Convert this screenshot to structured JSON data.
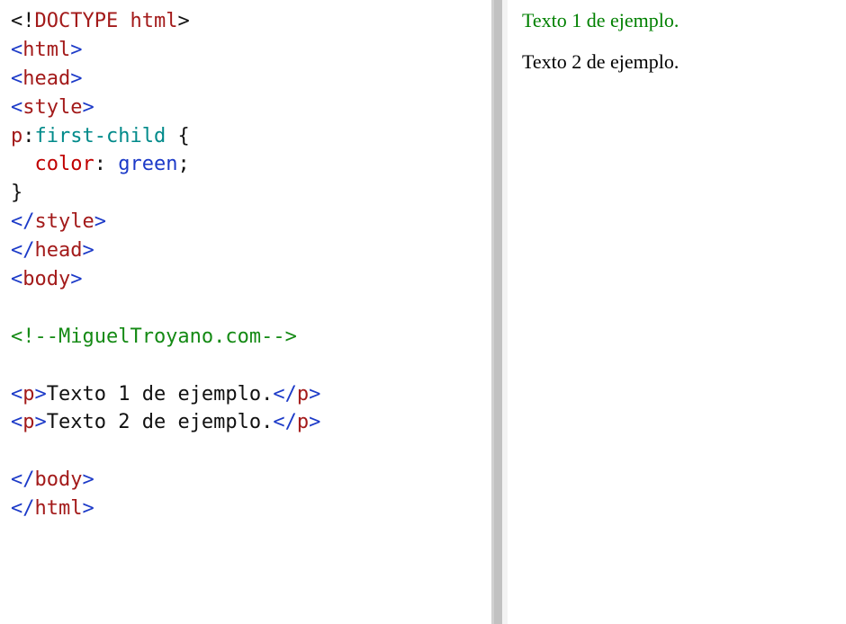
{
  "code": {
    "lines": [
      [
        {
          "cls": "t-punct",
          "text": "<!"
        },
        {
          "cls": "t-tag",
          "text": "DOCTYPE"
        },
        {
          "cls": "t-text",
          "text": " "
        },
        {
          "cls": "t-tag",
          "text": "html"
        },
        {
          "cls": "t-punct",
          "text": ">"
        }
      ],
      [
        {
          "cls": "t-angles",
          "text": "<"
        },
        {
          "cls": "t-tag",
          "text": "html"
        },
        {
          "cls": "t-angles",
          "text": ">"
        }
      ],
      [
        {
          "cls": "t-angles",
          "text": "<"
        },
        {
          "cls": "t-tag",
          "text": "head"
        },
        {
          "cls": "t-angles",
          "text": ">"
        }
      ],
      [
        {
          "cls": "t-angles",
          "text": "<"
        },
        {
          "cls": "t-tag",
          "text": "style"
        },
        {
          "cls": "t-angles",
          "text": ">"
        }
      ],
      [
        {
          "cls": "t-tag",
          "text": "p"
        },
        {
          "cls": "t-punct",
          "text": ":"
        },
        {
          "cls": "t-pseudo",
          "text": "first-child"
        },
        {
          "cls": "t-text",
          "text": " "
        },
        {
          "cls": "t-punct",
          "text": "{"
        }
      ],
      [
        {
          "cls": "t-text",
          "text": "  "
        },
        {
          "cls": "t-prop",
          "text": "color"
        },
        {
          "cls": "t-punct",
          "text": ": "
        },
        {
          "cls": "t-val",
          "text": "green"
        },
        {
          "cls": "t-punct",
          "text": ";"
        }
      ],
      [
        {
          "cls": "t-punct",
          "text": "}"
        }
      ],
      [
        {
          "cls": "t-angles",
          "text": "</"
        },
        {
          "cls": "t-tag",
          "text": "style"
        },
        {
          "cls": "t-angles",
          "text": ">"
        }
      ],
      [
        {
          "cls": "t-angles",
          "text": "</"
        },
        {
          "cls": "t-tag",
          "text": "head"
        },
        {
          "cls": "t-angles",
          "text": ">"
        }
      ],
      [
        {
          "cls": "t-angles",
          "text": "<"
        },
        {
          "cls": "t-tag",
          "text": "body"
        },
        {
          "cls": "t-angles",
          "text": ">"
        }
      ],
      [],
      [
        {
          "cls": "t-comment",
          "text": "<!--MiguelTroyano.com-->"
        }
      ],
      [],
      [
        {
          "cls": "t-angles",
          "text": "<"
        },
        {
          "cls": "t-tag",
          "text": "p"
        },
        {
          "cls": "t-angles",
          "text": ">"
        },
        {
          "cls": "t-text",
          "text": "Texto 1 de ejemplo."
        },
        {
          "cls": "t-angles",
          "text": "</"
        },
        {
          "cls": "t-tag",
          "text": "p"
        },
        {
          "cls": "t-angles",
          "text": ">"
        }
      ],
      [
        {
          "cls": "t-angles",
          "text": "<"
        },
        {
          "cls": "t-tag",
          "text": "p"
        },
        {
          "cls": "t-angles",
          "text": ">"
        },
        {
          "cls": "t-text",
          "text": "Texto 2 de ejemplo."
        },
        {
          "cls": "t-angles",
          "text": "</"
        },
        {
          "cls": "t-tag",
          "text": "p"
        },
        {
          "cls": "t-angles",
          "text": ">"
        }
      ],
      [],
      [
        {
          "cls": "t-angles",
          "text": "</"
        },
        {
          "cls": "t-tag",
          "text": "body"
        },
        {
          "cls": "t-angles",
          "text": ">"
        }
      ],
      [
        {
          "cls": "t-angles",
          "text": "</"
        },
        {
          "cls": "t-tag",
          "text": "html"
        },
        {
          "cls": "t-angles",
          "text": ">"
        }
      ]
    ]
  },
  "preview": {
    "p1": "Texto 1 de ejemplo.",
    "p2": "Texto 2 de ejemplo."
  }
}
